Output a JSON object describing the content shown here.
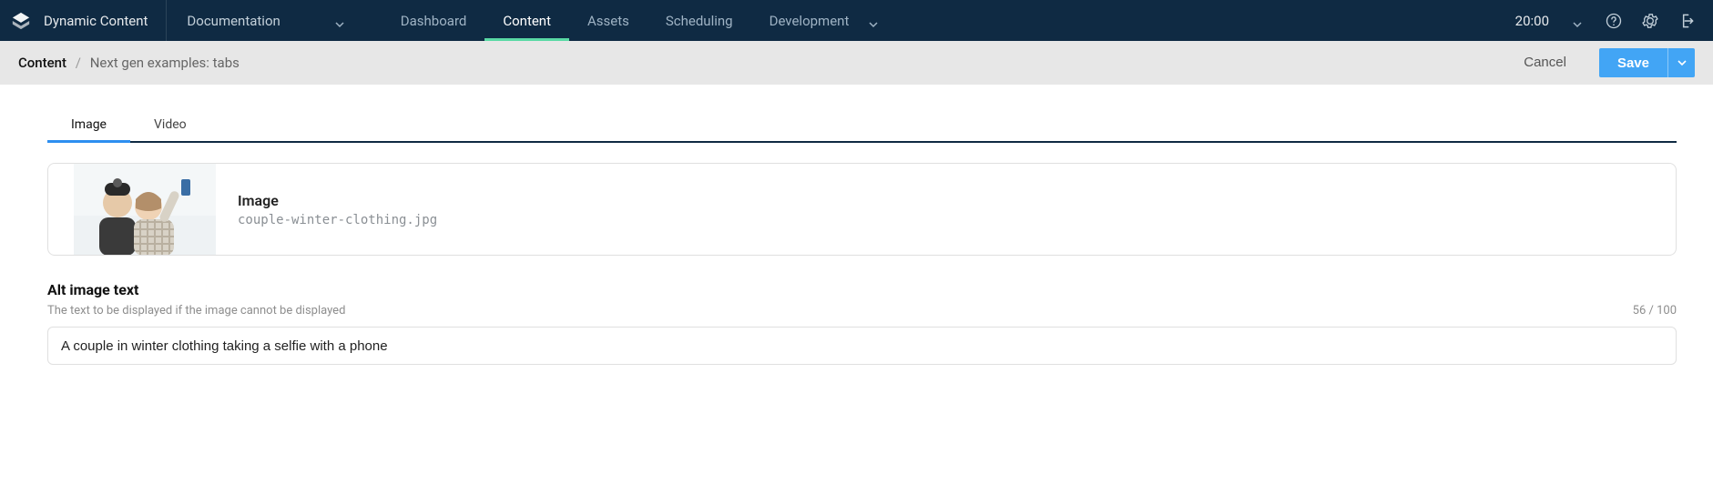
{
  "app": {
    "title": "Dynamic Content"
  },
  "docDropdown": {
    "label": "Documentation"
  },
  "nav": {
    "items": [
      "Dashboard",
      "Content",
      "Assets",
      "Scheduling",
      "Development"
    ],
    "activeIndex": 1
  },
  "clock": {
    "time": "20:00"
  },
  "breadcrumb": {
    "root": "Content",
    "sep": "/",
    "current": "Next gen examples: tabs"
  },
  "actions": {
    "cancel": "Cancel",
    "save": "Save"
  },
  "tabs": {
    "items": [
      "Image",
      "Video"
    ],
    "activeIndex": 0
  },
  "imageCard": {
    "label": "Image",
    "filename": "couple-winter-clothing.jpg"
  },
  "altField": {
    "label": "Alt image text",
    "help": "The text to be displayed if the image cannot be displayed",
    "counter": "56 / 100",
    "value": "A couple in winter clothing taking a selfie with a phone"
  }
}
